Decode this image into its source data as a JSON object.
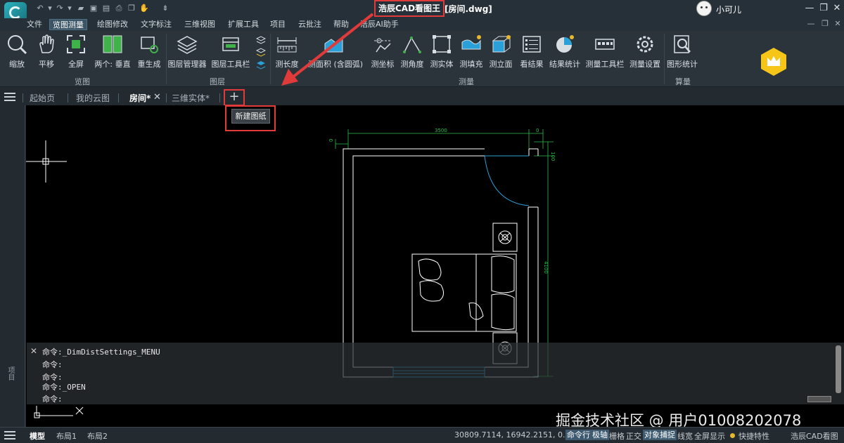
{
  "app": {
    "title": "浩辰CAD看图王",
    "document": "[房间.dwg]"
  },
  "user": {
    "name": "小可儿"
  },
  "window": {
    "minimize": "—",
    "restore": "❐",
    "close": "✕"
  },
  "menu": {
    "items": [
      "文件",
      "览图测量",
      "绘图修改",
      "文字标注",
      "三维视图",
      "扩展工具",
      "项目",
      "云批注",
      "帮助",
      "浩辰AI助手"
    ],
    "active": "览图测量"
  },
  "ribbon": {
    "view": {
      "zoom": "缩放",
      "pan": "平移",
      "fullscreen": "全屏",
      "two": "两个: 垂直",
      "regen": "重生成",
      "group": "览图"
    },
    "layer": {
      "manager": "图层管理器",
      "toolbar": "图层工具栏",
      "group": "图层"
    },
    "measure": {
      "length": "测长度",
      "area": "测面积 (含圆弧)",
      "coord": "测坐标",
      "angle": "测角度",
      "solid": "测实体",
      "fill": "测填充",
      "elevation": "测立面",
      "results": "看结果",
      "stats": "结果统计",
      "toolbar": "测量工具栏",
      "settings": "测量设置",
      "group": "测量"
    },
    "calc": {
      "figure_stats": "图形统计",
      "group": "算量"
    }
  },
  "tabs": {
    "items": [
      "起始页",
      "我的云图",
      "房间*",
      "三维实体*"
    ],
    "active": "房间*",
    "new_tooltip": "新建图纸"
  },
  "side": {
    "label": "项目"
  },
  "drawing": {
    "dim_width": "3500",
    "dim_right": "0",
    "dim_left": "0",
    "dim_height": "4100",
    "dim_top_small": "100"
  },
  "command": {
    "lines": [
      "命令:_DimDistSettings_MENU",
      "命令:",
      "命令:",
      "命令:_OPEN",
      "命令:"
    ]
  },
  "watermark": "掘金技术社区 @ 用户01008202078",
  "status": {
    "layouts": [
      "模型",
      "布局1",
      "布局2"
    ],
    "coords": "30809.7114, 16942.2151, 0.0000",
    "toggles": [
      "命令行",
      "极轴",
      "栅格",
      "正交",
      "对象捕捉",
      "线宽",
      "全屏显示"
    ],
    "toggles_on": [
      "命令行",
      "极轴",
      "对象捕捉"
    ],
    "quick": "快捷特性",
    "brand": "浩辰CAD看图王"
  }
}
